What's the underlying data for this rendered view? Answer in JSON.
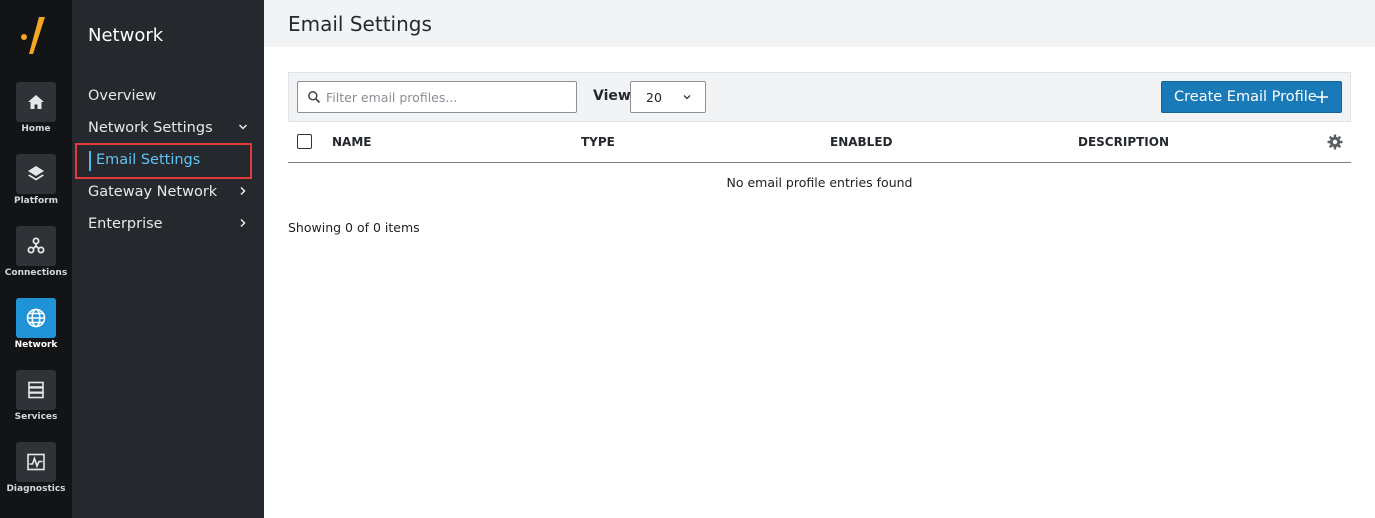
{
  "rail": {
    "items": [
      {
        "label": "Home",
        "icon": "home-icon"
      },
      {
        "label": "Platform",
        "icon": "layers-icon"
      },
      {
        "label": "Connections",
        "icon": "connections-icon"
      },
      {
        "label": "Network",
        "icon": "globe-icon",
        "active": true
      },
      {
        "label": "Services",
        "icon": "server-icon"
      },
      {
        "label": "Diagnostics",
        "icon": "pulse-icon"
      }
    ],
    "logo_color": "#f5a623",
    "active_color": "#1f93d6"
  },
  "sidebar": {
    "title": "Network",
    "items": [
      {
        "label": "Overview"
      },
      {
        "label": "Network Settings",
        "expanded": true
      },
      {
        "label": "Email Settings",
        "selected": true
      },
      {
        "label": "Gateway Network"
      },
      {
        "label": "Enterprise"
      }
    ]
  },
  "main": {
    "title": "Email Settings",
    "search": {
      "placeholder": "Filter email profiles...",
      "value": ""
    },
    "view": {
      "label": "View",
      "value": "20"
    },
    "create_button": {
      "label": "Create Email Profile"
    },
    "table": {
      "columns": [
        "NAME",
        "TYPE",
        "ENABLED",
        "DESCRIPTION"
      ],
      "rows": [],
      "empty_message": "No email profile entries found"
    },
    "showing": "Showing 0 of 0 items"
  }
}
